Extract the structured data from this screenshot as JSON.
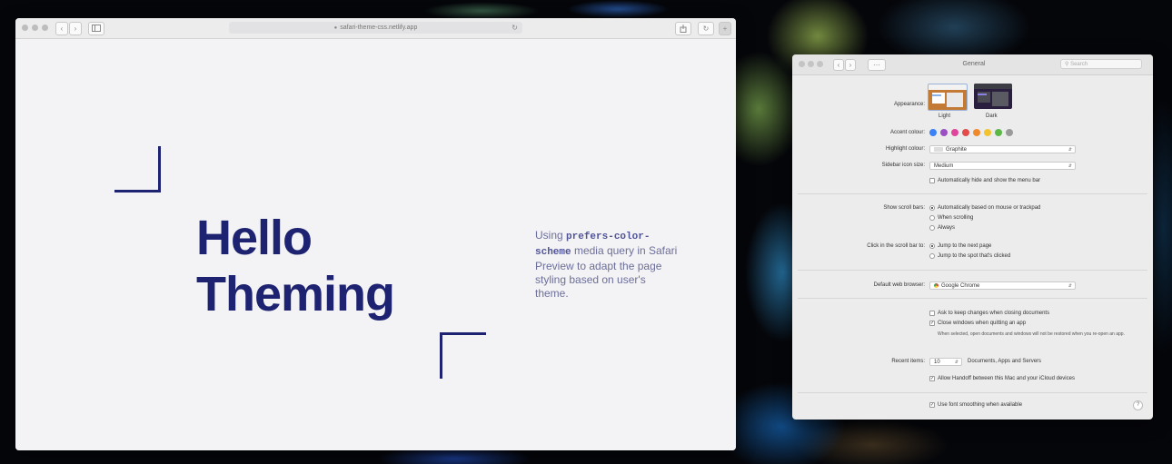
{
  "safari": {
    "url": "safari-theme-css.netlify.app",
    "nav_back": "‹",
    "nav_forward": "›",
    "page": {
      "heading_line1": "Hello",
      "heading_line2": "Theming",
      "blurb_before": "Using ",
      "blurb_code": "prefers-color-scheme",
      "blurb_after": " media query in Safari Preview to adapt the page styling based on user's theme."
    }
  },
  "prefs": {
    "title": "General",
    "search_placeholder": "Search",
    "appearance": {
      "label": "Appearance:",
      "options": [
        "Light",
        "Dark"
      ]
    },
    "accent": {
      "label": "Accent colour:",
      "colors": [
        "#3a82f6",
        "#9b4fc4",
        "#e0459b",
        "#e34b4b",
        "#ef8a2c",
        "#f2c32f",
        "#5bb847",
        "#9a9a9a"
      ]
    },
    "highlight": {
      "label": "Highlight colour:",
      "value": "Graphite"
    },
    "sidebar": {
      "label": "Sidebar icon size:",
      "value": "Medium"
    },
    "menubar_check": "Automatically hide and show the menu bar",
    "scroll": {
      "label": "Show scroll bars:",
      "options": [
        "Automatically based on mouse or trackpad",
        "When scrolling",
        "Always"
      ]
    },
    "click": {
      "label": "Click in the scroll bar to:",
      "options": [
        "Jump to the next page",
        "Jump to the spot that's clicked"
      ]
    },
    "browser": {
      "label": "Default web browser:",
      "value": "Google Chrome"
    },
    "ask_keep": "Ask to keep changes when closing documents",
    "close_windows": "Close windows when quitting an app",
    "close_note": "When selected, open documents and windows will not be restored when you re-open an app.",
    "recent": {
      "label": "Recent items:",
      "value": "10",
      "suffix": "Documents, Apps and Servers"
    },
    "handoff": "Allow Handoff between this Mac and your iCloud devices",
    "font_smoothing": "Use font smoothing when available",
    "help": "?"
  }
}
